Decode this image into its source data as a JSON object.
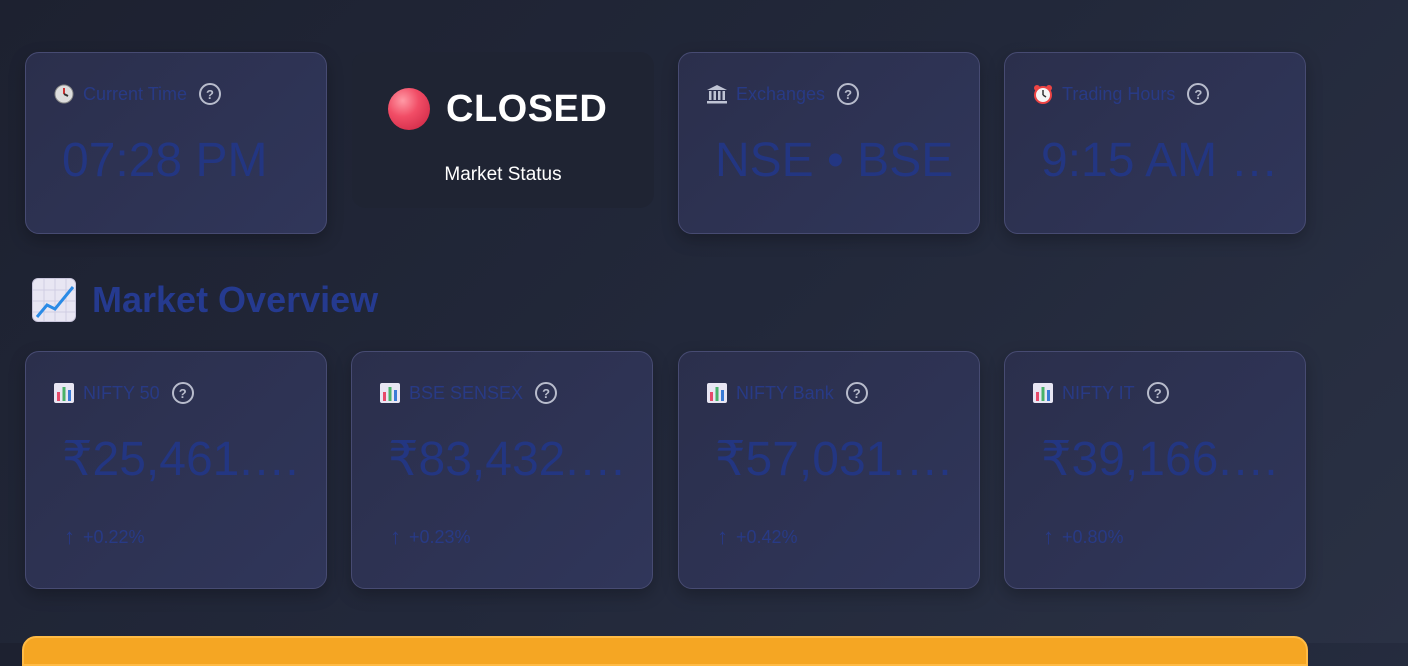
{
  "top_metrics": [
    {
      "label": "Current Time",
      "icon": "clock-icon",
      "value": "07:28 PM"
    },
    {
      "label": "Exchanges",
      "icon": "bank-icon",
      "value": "NSE • BSE"
    },
    {
      "label": "Trading Hours",
      "icon": "alarm-clock-icon",
      "value": "9:15 AM - 3:30 PM"
    }
  ],
  "market_status": {
    "state": "CLOSED",
    "label": "Market Status",
    "dot_color": "#f14d66"
  },
  "section": {
    "title": "Market Overview",
    "icon": "chart-increasing-icon"
  },
  "indices": [
    {
      "label": "NIFTY 50",
      "icon": "bar-chart-icon",
      "value": "₹25,461.00",
      "delta": "+0.22%"
    },
    {
      "label": "BSE SENSEX",
      "icon": "bar-chart-icon",
      "value": "₹83,432.89",
      "delta": "+0.23%"
    },
    {
      "label": "NIFTY Bank",
      "icon": "bar-chart-icon",
      "value": "₹57,031.90",
      "delta": "+0.42%"
    },
    {
      "label": "NIFTY IT",
      "icon": "bar-chart-icon",
      "value": "₹39,166.35",
      "delta": "+0.80%"
    }
  ],
  "colors": {
    "accent": "#253a8f",
    "banner": "#f5a623"
  }
}
